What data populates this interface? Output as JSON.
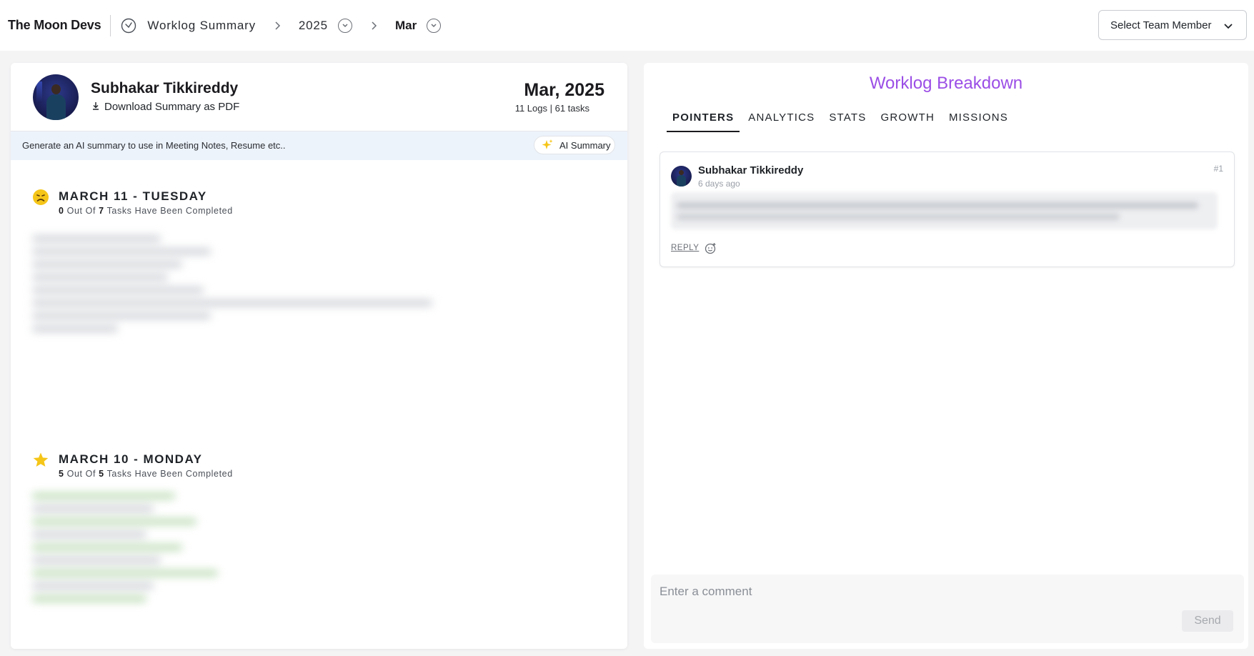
{
  "header": {
    "brand": "The Moon Devs",
    "breadcrumb": {
      "section": "Worklog Summary",
      "year": "2025",
      "month": "Mar"
    },
    "team_select_label": "Select Team Member"
  },
  "summary": {
    "user_name": "Subhakar Tikkireddy",
    "download_label": "Download Summary as PDF",
    "period": "Mar, 2025",
    "logs_info": "11 Logs | 61 tasks",
    "ai_prompt": "Generate an AI summary to use in Meeting Notes, Resume etc..",
    "ai_button": "AI Summary"
  },
  "days": [
    {
      "title": "MARCH 11 - TUESDAY",
      "completed": "0",
      "total": "7",
      "out_of": "Out Of",
      "suffix": "Tasks Have Been Completed",
      "icon": "frown-face-icon"
    },
    {
      "title": "MARCH 10 - MONDAY",
      "completed": "5",
      "total": "5",
      "out_of": "Out Of",
      "suffix": "Tasks Have Been Completed",
      "icon": "star-icon"
    }
  ],
  "breakdown": {
    "title": "Worklog Breakdown",
    "tabs": [
      "POINTERS",
      "ANALYTICS",
      "STATS",
      "GROWTH",
      "MISSIONS"
    ],
    "active_tab": "POINTERS",
    "comments": [
      {
        "author": "Subhakar Tikkireddy",
        "time": "6 days ago",
        "number": "#1",
        "reply_label": "REPLY"
      }
    ],
    "comment_placeholder": "Enter a comment",
    "send_label": "Send"
  },
  "colors": {
    "accent_purple": "#9b4ee6",
    "ai_bar_bg": "#edf3fb",
    "star": "#f5c518"
  }
}
